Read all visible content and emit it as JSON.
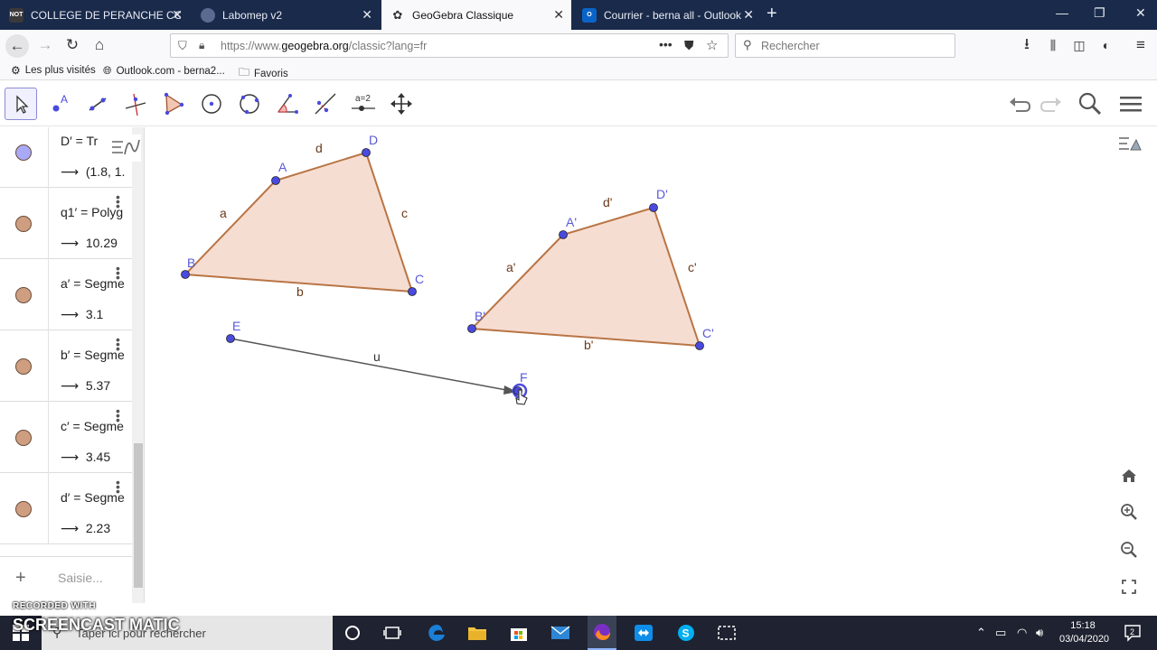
{
  "browser": {
    "tabs": [
      {
        "title": "COLLEGE DE PERANCHE COLL",
        "favicon": "NOT",
        "active": false
      },
      {
        "title": "Labomep v2",
        "favicon": "",
        "active": false
      },
      {
        "title": "GeoGebra Classique",
        "favicon": "",
        "active": true
      },
      {
        "title": "Courrier - berna all - Outlook",
        "favicon": "O",
        "active": false
      }
    ],
    "url_prefix": "https://www.",
    "url_domain": "geogebra.org",
    "url_path": "/classic?lang=fr",
    "search_placeholder": "Rechercher",
    "bookmarks": [
      "Les plus visités",
      "Outlook.com - berna2...",
      "Favoris"
    ]
  },
  "toolbar": {
    "tools": [
      "move-tool",
      "point-tool",
      "line-tool",
      "perpendicular-tool",
      "polygon-tool",
      "circle-center-tool",
      "circle-three-points-tool",
      "angle-tool",
      "reflect-tool",
      "slider-tool",
      "move-view-tool"
    ],
    "slider_label": "a=2"
  },
  "algebra": {
    "rows": [
      {
        "def": "D′ = Tr",
        "val": "(1.8, 1.",
        "color": "#a9a9f7"
      },
      {
        "def": "q1′ = Polyg",
        "val": "10.29",
        "color": "#cf9e80"
      },
      {
        "def": "a′ = Segme",
        "val": "3.1",
        "color": "#cf9e80"
      },
      {
        "def": "b′ = Segme",
        "val": "5.37",
        "color": "#cf9e80"
      },
      {
        "def": "c′ = Segme",
        "val": "3.45",
        "color": "#cf9e80"
      },
      {
        "def": "d′ = Segme",
        "val": "2.23",
        "color": "#cf9e80"
      }
    ],
    "arrow": "⟶",
    "input_placeholder": "Saisie..."
  },
  "geometry": {
    "labels": {
      "A": "A",
      "B": "B",
      "C": "C",
      "D": "D",
      "E": "E",
      "F": "F",
      "A2": "A'",
      "B2": "B'",
      "C2": "C'",
      "D2": "D'",
      "a": "a",
      "b": "b",
      "c": "c",
      "d": "d",
      "a2": "a'",
      "b2": "b'",
      "c2": "c'",
      "d2": "d'",
      "u": "u"
    },
    "colors": {
      "polygon_fill": "#f6ddd2",
      "polygon_stroke": "#b97545",
      "point": "#4a4ae0",
      "vector": "#555555",
      "label_point": "#5a5ad8",
      "label_segment": "#6b3a1a"
    }
  },
  "taskbar": {
    "search_placeholder": "Taper ici pour rechercher",
    "time": "15:18",
    "date": "03/04/2020",
    "notification_count": "2"
  },
  "watermark": {
    "line1": "RECORDED WITH",
    "line2": "SCREENCAST MATIC"
  }
}
